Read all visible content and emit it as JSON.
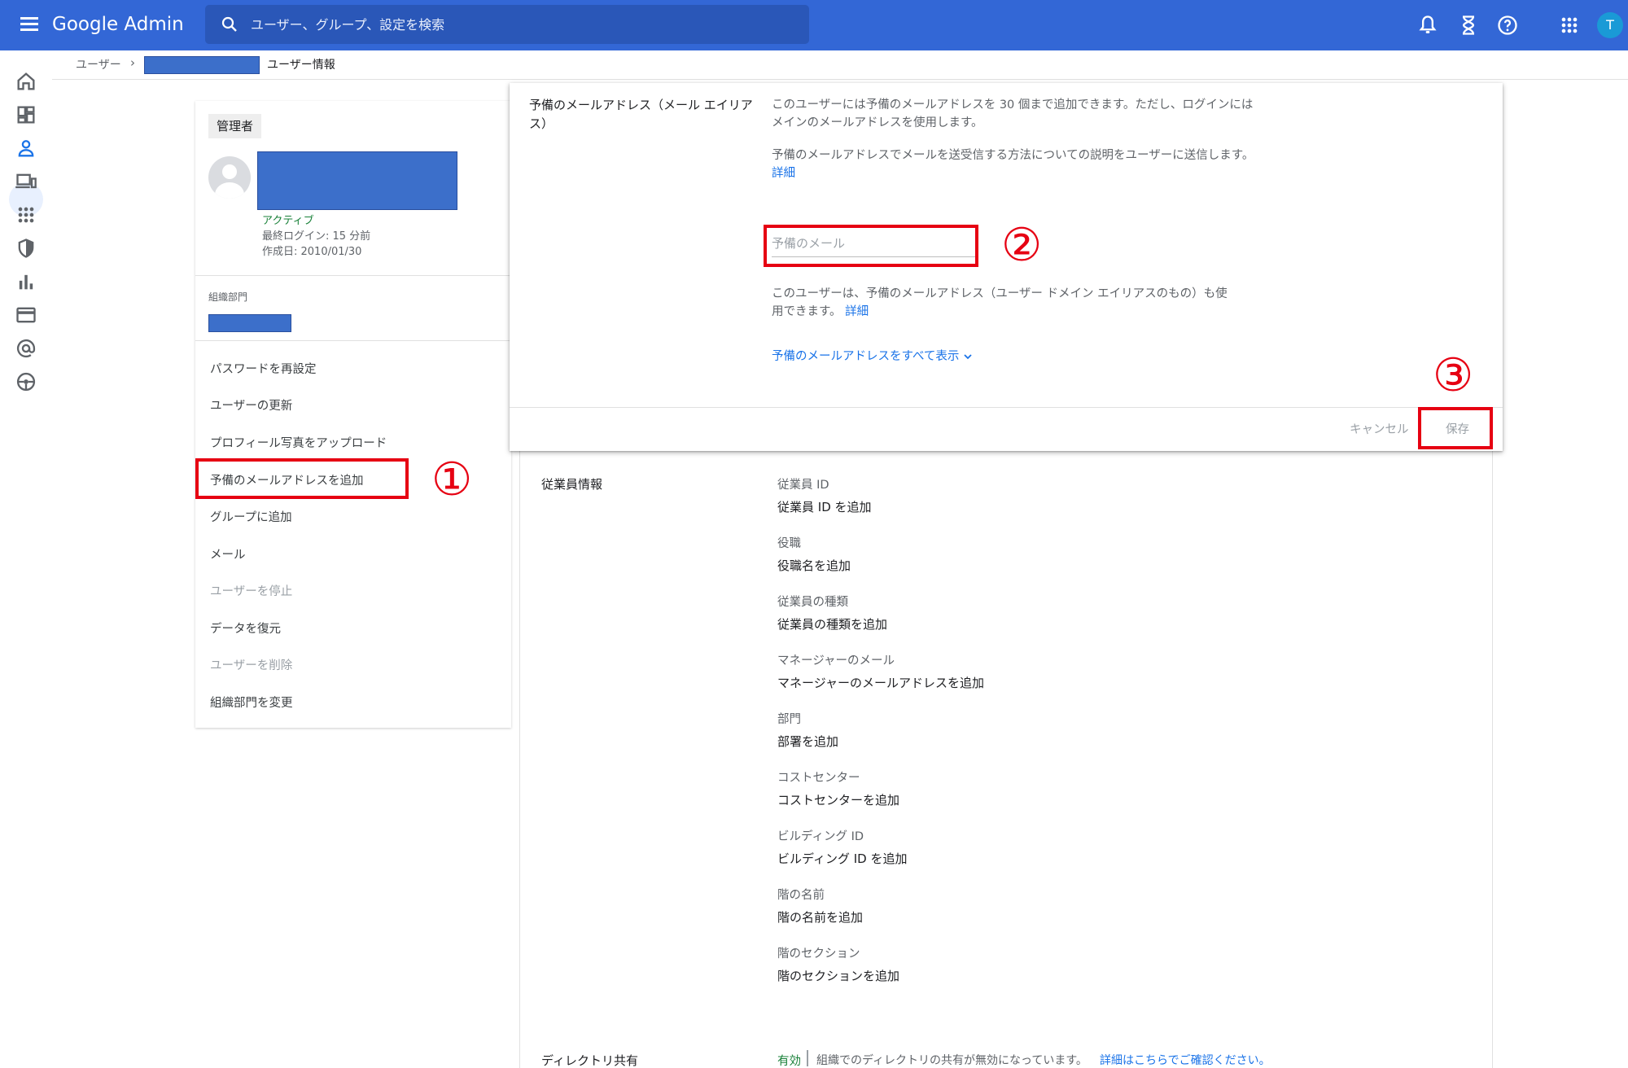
{
  "app": {
    "title": "Google Admin"
  },
  "search": {
    "placeholder": "ユーザー、グループ、設定を検索"
  },
  "topbar": {
    "icons": [
      "notifications-icon",
      "hourglass-icon",
      "help-icon",
      "apps-grid-icon"
    ],
    "account_initial": "T"
  },
  "rail": {
    "items": [
      "home-icon",
      "dashboard-icon",
      "users-icon",
      "devices-icon",
      "apps-icon",
      "security-icon",
      "reports-icon",
      "billing-icon",
      "domains-icon",
      "support-icon"
    ],
    "active": "users-icon"
  },
  "breadcrumb": {
    "root": "ユーザー",
    "separator": "›",
    "current": "ユーザー情報"
  },
  "user": {
    "role_badge": "管理者",
    "status": "アクティブ",
    "last_login": "最終ログイン: 15 分前",
    "created": "作成日: 2010/01/30",
    "org_unit_label": "組織部門"
  },
  "actions": [
    {
      "label": "パスワードを再設定",
      "enabled": true
    },
    {
      "label": "ユーザーの更新",
      "enabled": true
    },
    {
      "label": "プロフィール写真をアップロード",
      "enabled": true
    },
    {
      "label": "予備のメールアドレスを追加",
      "enabled": true
    },
    {
      "label": "グループに追加",
      "enabled": true
    },
    {
      "label": "メール",
      "enabled": true
    },
    {
      "label": "ユーザーを停止",
      "enabled": false
    },
    {
      "label": "データを復元",
      "enabled": true
    },
    {
      "label": "ユーザーを削除",
      "enabled": false
    },
    {
      "label": "組織部門を変更",
      "enabled": true
    }
  ],
  "popup": {
    "title": "予備のメールアドレス（メール エイリアス）",
    "desc1": "このユーザーには予備のメールアドレスを 30 個まで追加できます。ただし、ログインにはメインのメールアドレスを使用します。",
    "desc2": "予備のメールアドレスでメールを送受信する方法についての説明をユーザーに送信します。",
    "desc2_link": "詳細",
    "input_placeholder": "予備のメール",
    "desc3": "このユーザーは、予備のメールアドレス（ユーザー ドメイン エイリアスのもの）も使用できます。",
    "desc3_link": "詳細",
    "show_all": "予備のメールアドレスをすべて表示",
    "cancel": "キャンセル",
    "save": "保存"
  },
  "employee": {
    "section_title": "従業員情報",
    "fields": [
      {
        "label": "従業員 ID",
        "value": "従業員 ID を追加"
      },
      {
        "label": "役職",
        "value": "役職名を追加"
      },
      {
        "label": "従業員の種類",
        "value": "従業員の種類を追加"
      },
      {
        "label": "マネージャーのメール",
        "value": "マネージャーのメールアドレスを追加"
      },
      {
        "label": "部門",
        "value": "部署を追加"
      },
      {
        "label": "コストセンター",
        "value": "コストセンターを追加"
      },
      {
        "label": "ビルディング ID",
        "value": "ビルディング ID を追加"
      },
      {
        "label": "階の名前",
        "value": "階の名前を追加"
      },
      {
        "label": "階のセクション",
        "value": "階のセクションを追加"
      }
    ]
  },
  "directory": {
    "section_title": "ディレクトリ共有",
    "status": "有効",
    "text": "組織でのディレクトリの共有が無効になっています。",
    "link": "詳細はこちらでご確認ください。"
  },
  "annotations": {
    "step1": "①",
    "step2": "②",
    "step3": "③"
  },
  "colors": {
    "topbar": "#3367d6",
    "accent": "#1a73e8",
    "annotation": "#e60012",
    "active": "#188038"
  }
}
